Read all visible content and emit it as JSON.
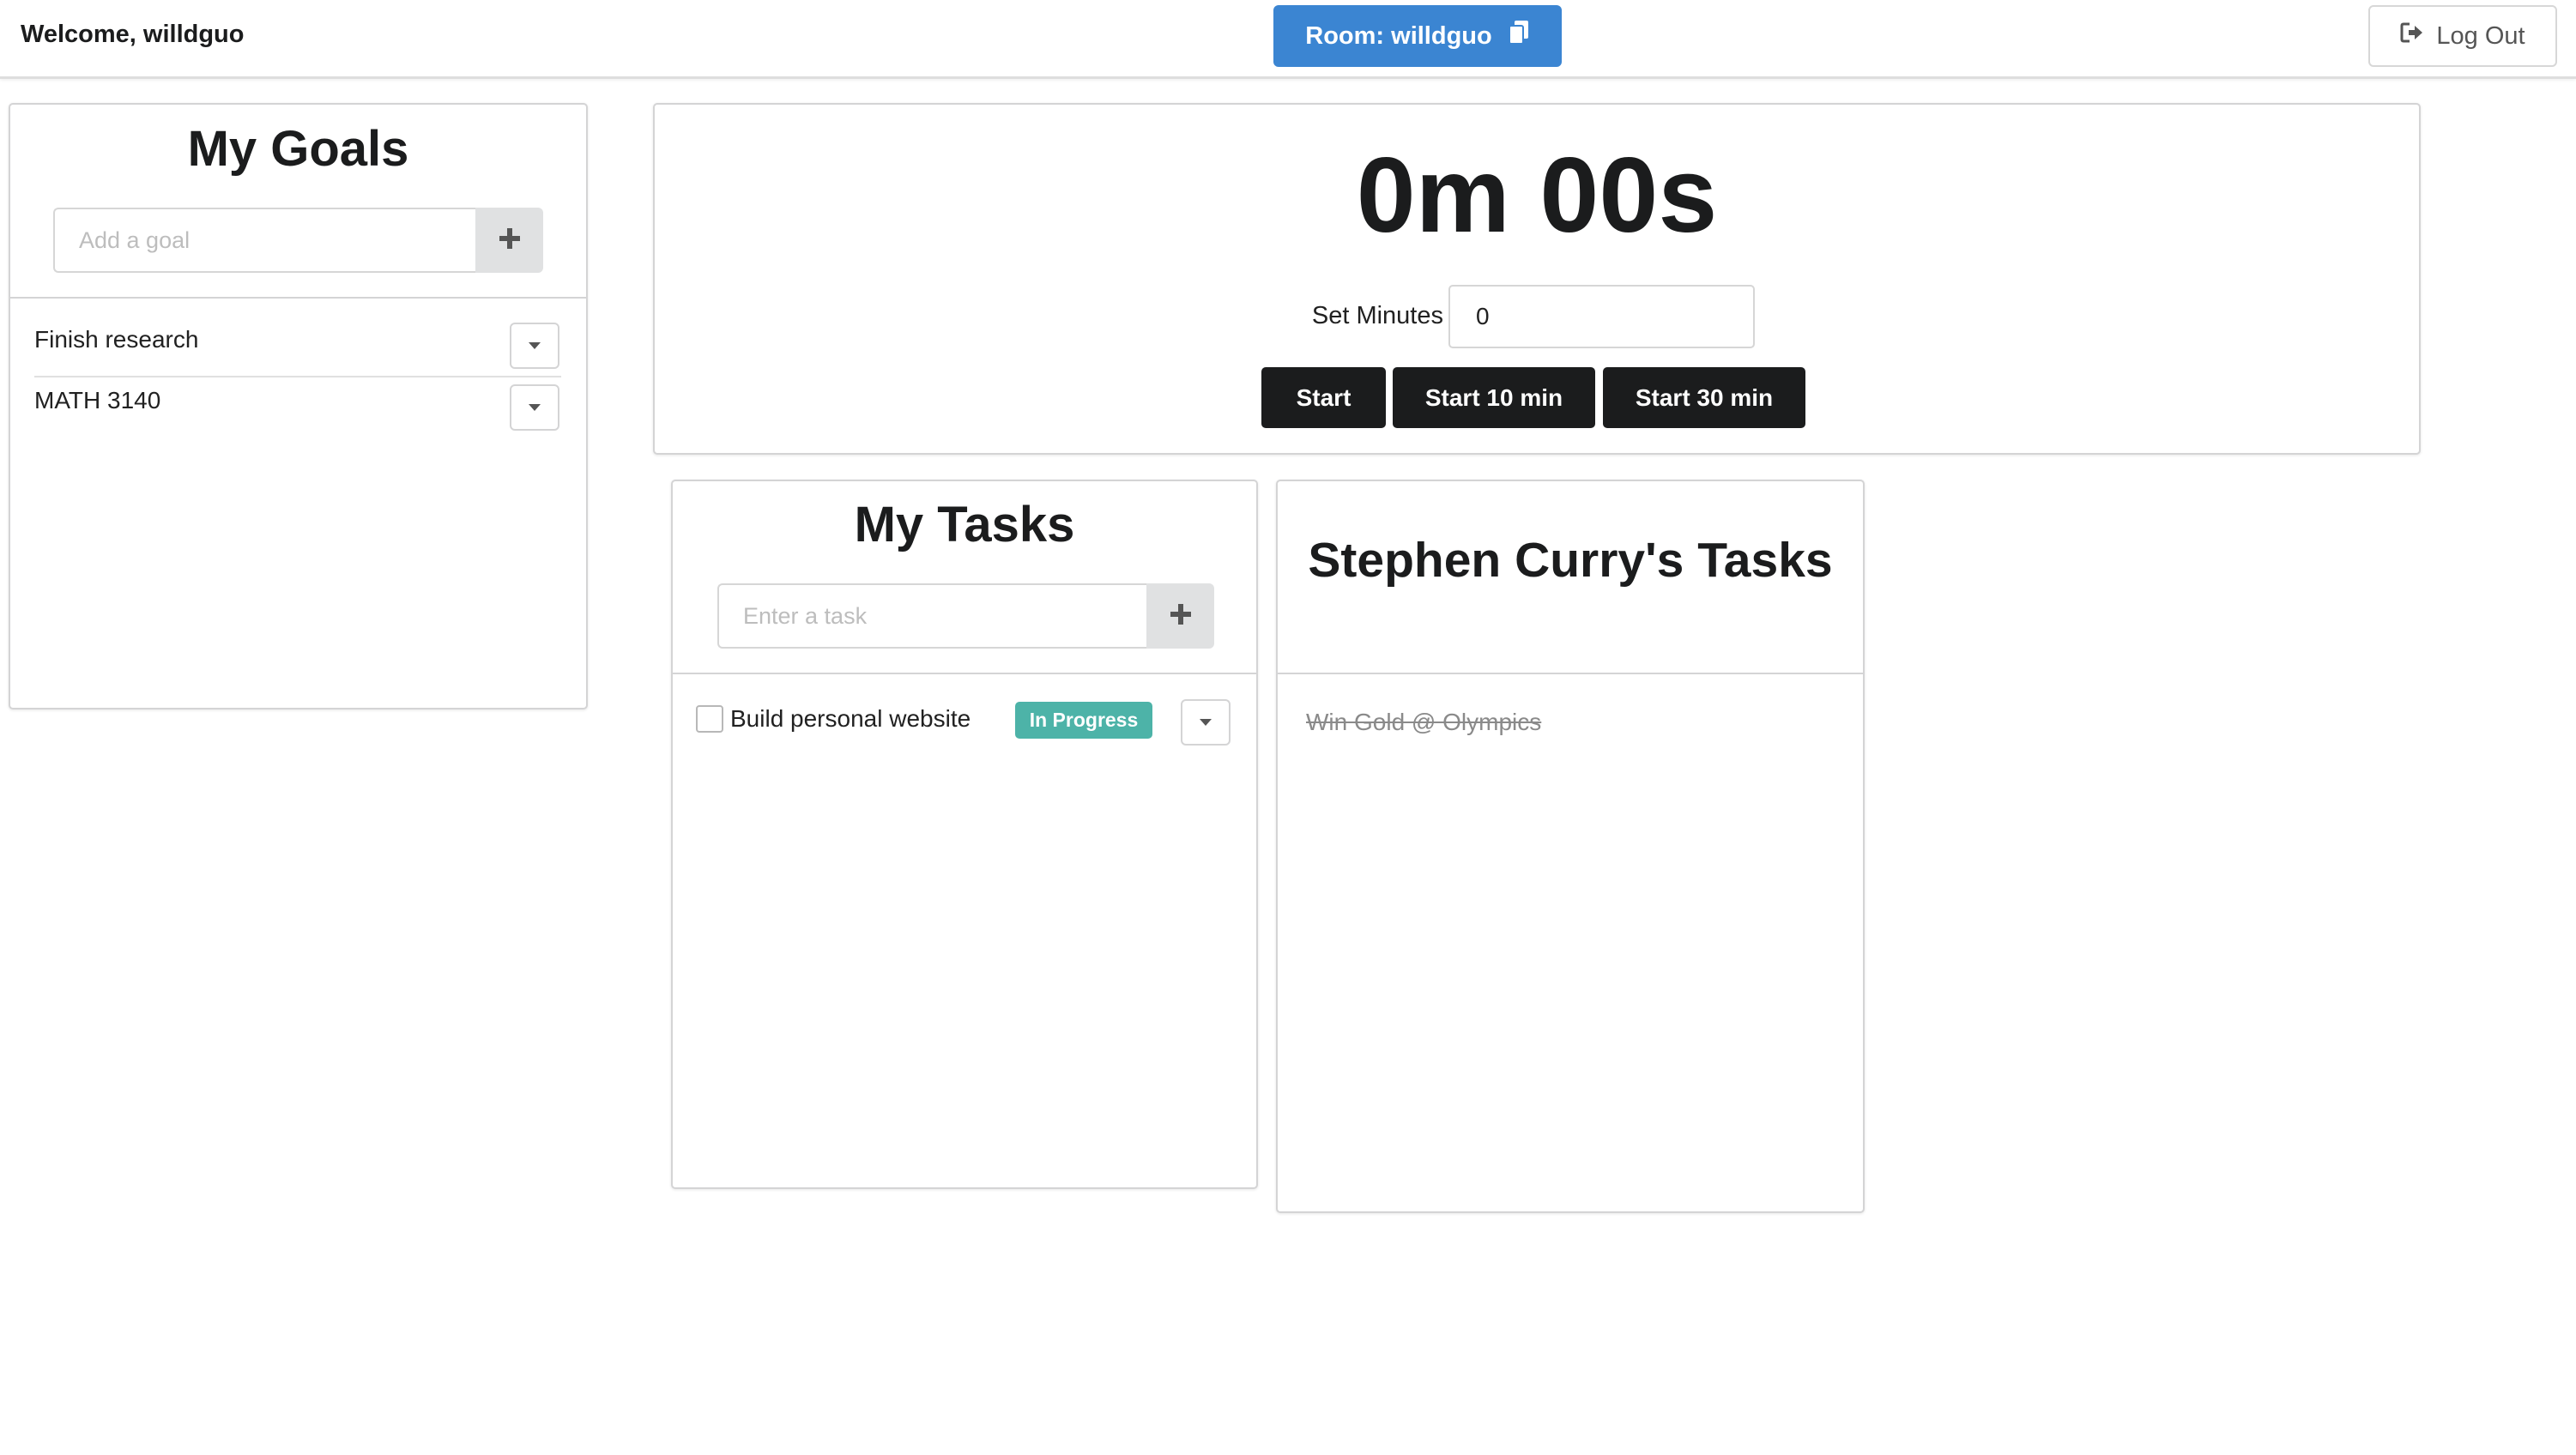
{
  "topbar": {
    "welcome": "Welcome, willdguo",
    "room_button": "Room: willdguo",
    "logout_button": "Log Out"
  },
  "goals": {
    "title": "My Goals",
    "input_placeholder": "Add a goal",
    "items": [
      {
        "label": "Finish research"
      },
      {
        "label": "MATH 3140"
      }
    ]
  },
  "timer": {
    "display": "0m 00s",
    "set_minutes_label": "Set Minutes",
    "minutes_value": "0",
    "buttons": [
      "Start",
      "Start 10 min",
      "Start 30 min"
    ]
  },
  "my_tasks": {
    "title": "My Tasks",
    "input_placeholder": "Enter a task",
    "items": [
      {
        "label": "Build personal website",
        "status": "In Progress",
        "checked": false
      }
    ]
  },
  "friend_tasks": {
    "title": "Stephen Curry's Tasks",
    "items": [
      {
        "label": "Win Gold @ Olympics",
        "completed": true
      }
    ]
  },
  "colors": {
    "primary_blue": "#3b85d2",
    "status_teal": "#4db3a8",
    "dark_button": "#1b1c1d"
  },
  "icons": {
    "room": "copy-icon",
    "logout": "sign-out-icon",
    "add": "plus-icon",
    "dropdown": "caret-down-icon"
  }
}
